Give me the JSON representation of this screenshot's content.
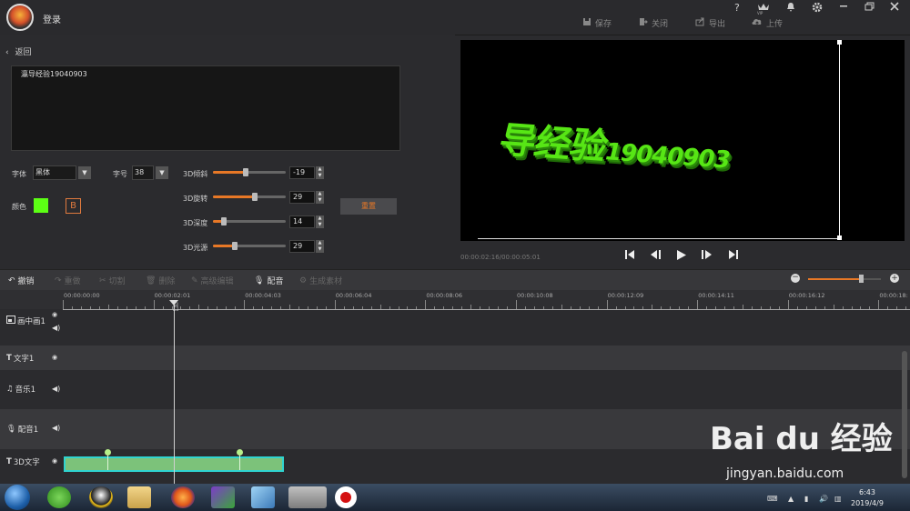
{
  "titlebar": {
    "login": "登录",
    "window_icons": [
      "help-icon",
      "vip-icon",
      "bell-icon",
      "settings-icon",
      "minimize-icon",
      "maximize-icon",
      "close-icon"
    ],
    "help_glyph": "?",
    "vip_label": "VIP",
    "actions": [
      {
        "label": "保存",
        "icon": "save-icon"
      },
      {
        "label": "关闭",
        "icon": "exit-icon"
      },
      {
        "label": "导出",
        "icon": "export-icon"
      },
      {
        "label": "上传",
        "icon": "upload-icon"
      }
    ]
  },
  "editor": {
    "back_label": "返回",
    "text_value": "瀛导经验19040903",
    "font_label": "字体",
    "font_value": "黑体",
    "size_label": "字号",
    "size_value": "38",
    "color_label": "颜色",
    "color_value": "#5cff14",
    "bold_label": "B",
    "reset_label": "重置",
    "sliders": [
      {
        "label": "3D倾斜",
        "value": "-19",
        "fraction": 0.45
      },
      {
        "label": "3D旋转",
        "value": "29",
        "fraction": 0.57
      },
      {
        "label": "3D深度",
        "value": "14",
        "fraction": 0.15
      },
      {
        "label": "3D光源",
        "value": "29",
        "fraction": 0.3
      }
    ]
  },
  "preview": {
    "text_main": "导经验",
    "text_num": "19040903",
    "text_color": "#57e615",
    "timecode": "00:00:02:16/00:00:05:01"
  },
  "toolbar": {
    "items": [
      {
        "label": "撤销",
        "icon": "undo-icon",
        "enabled": true
      },
      {
        "label": "重做",
        "icon": "redo-icon",
        "enabled": false
      },
      {
        "label": "切割",
        "icon": "scissors-icon",
        "enabled": false
      },
      {
        "label": "删除",
        "icon": "trash-icon",
        "enabled": false
      },
      {
        "label": "高级编辑",
        "icon": "pencil-icon",
        "enabled": false
      },
      {
        "label": "配音",
        "icon": "microphone-icon",
        "enabled": true
      },
      {
        "label": "生成素材",
        "icon": "gear-icon",
        "enabled": false
      }
    ],
    "zoom_fraction": 0.73
  },
  "timeline": {
    "ruler_labels": [
      "00:00:00:00",
      "00:00:02:01",
      "00:00:04:03",
      "00:00:06:04",
      "00:00:08:06",
      "00:00:10:08",
      "00:00:12:09",
      "00:00:14:11",
      "00:00:16:12",
      "00:00:18:"
    ],
    "tracks": [
      {
        "label": "画中画1",
        "icon": "pip-icon"
      },
      {
        "label": "文字1",
        "icon": "text-icon"
      },
      {
        "label": "音乐1",
        "icon": "music-icon"
      },
      {
        "label": "配音1",
        "icon": "microphone-icon"
      },
      {
        "label": "3D文字",
        "icon": "text-icon"
      }
    ],
    "clip_color": "#7cc27a"
  },
  "taskbar": {
    "time": "6:43",
    "date": "2019/4/9"
  },
  "watermark": {
    "brand": "Bai du 经验",
    "url": "jingyan.baidu.com"
  }
}
